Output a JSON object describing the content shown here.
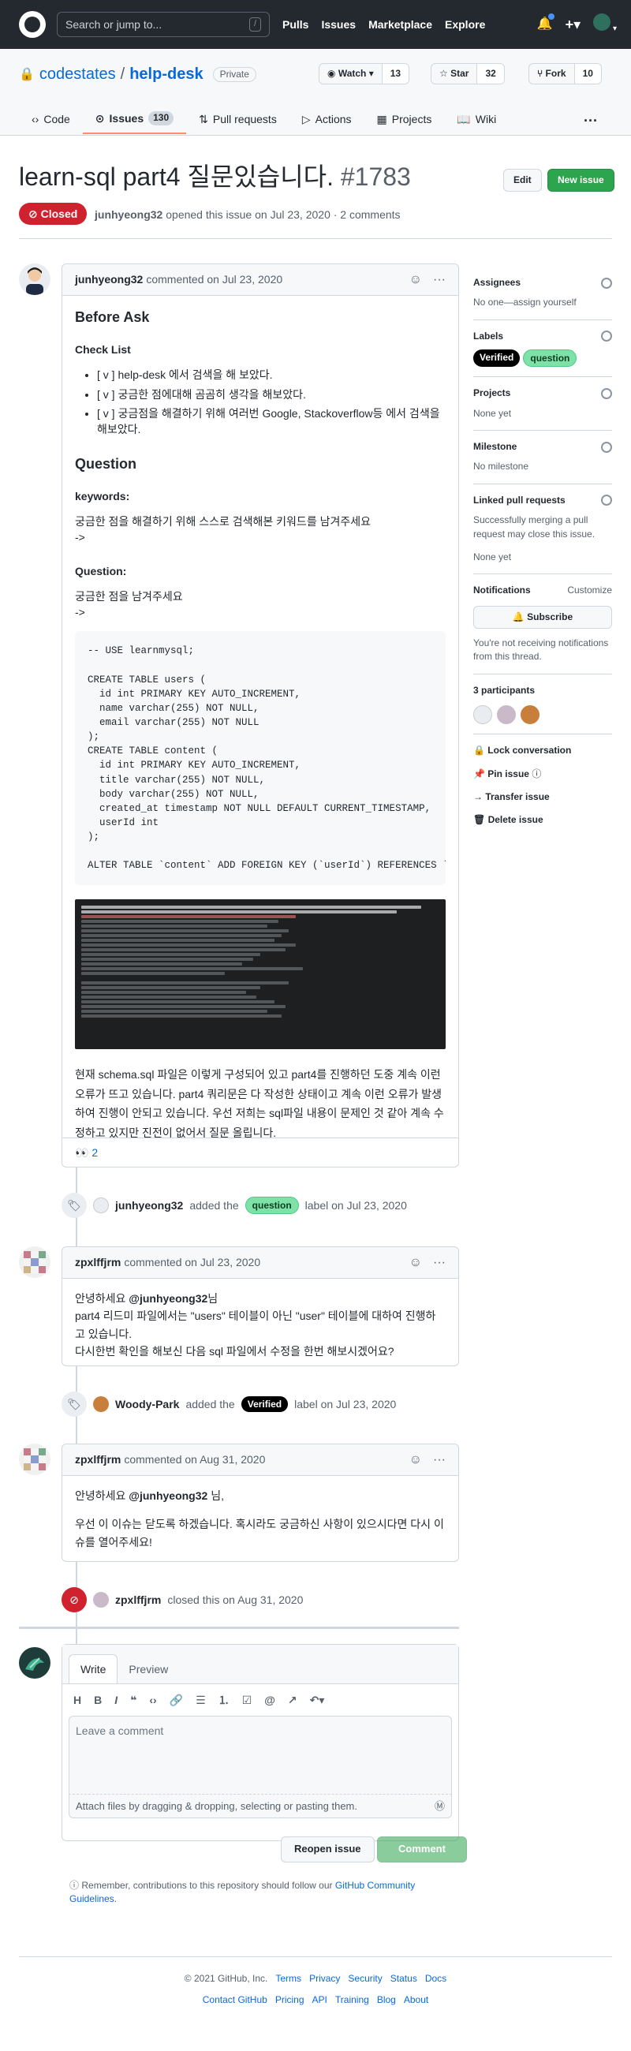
{
  "header": {
    "search_placeholder": "Search or jump to...",
    "search_kbd": "/",
    "nav": [
      "Pulls",
      "Issues",
      "Marketplace",
      "Explore"
    ]
  },
  "repo": {
    "owner": "codestates",
    "separator": "/",
    "name": "help-desk",
    "visibility": "Private",
    "watch_label": "Watch",
    "watch_count": "13",
    "star_label": "Star",
    "star_count": "32",
    "fork_label": "Fork",
    "fork_count": "10",
    "tabs": [
      {
        "label": "Code",
        "icon": "code-icon"
      },
      {
        "label": "Issues",
        "icon": "issue-icon",
        "count": "130"
      },
      {
        "label": "Pull requests",
        "icon": "pull-request-icon"
      },
      {
        "label": "Actions",
        "icon": "play-icon"
      },
      {
        "label": "Projects",
        "icon": "project-icon"
      },
      {
        "label": "Wiki",
        "icon": "book-icon"
      }
    ]
  },
  "issue": {
    "title": "learn-sql part4 질문있습니다.",
    "number": "#1783",
    "edit_label": "Edit",
    "new_issue_label": "New issue",
    "state": "Closed",
    "author": "junhyeong32",
    "meta_text": "opened this issue on Jul 23, 2020 · 2 comments"
  },
  "comment1": {
    "author": "junhyeong32",
    "meta": "commented on Jul 23, 2020",
    "h_before_ask": "Before Ask",
    "h_checklist": "Check List",
    "checklist": [
      "[ v ] help-desk 에서 검색을 해 보았다.",
      "[ v ] 궁금한 점에대해 곰곰히 생각을 해보았다.",
      "[ v ] 궁금점을 해결하기 위해 여러번 Google, Stackoverflow등 에서 검색을 해보았다."
    ],
    "h_question": "Question",
    "h_keywords": "keywords:",
    "keywords_text": "궁금한 점을 해결하기 위해 스스로 검색해본 키워드를 남겨주세요",
    "arrow1": "->",
    "h_question2": "Question:",
    "question_text": "궁금한 점을 남겨주세요",
    "arrow2": "->",
    "code": "-- USE learnmysql;\n\nCREATE TABLE users (\n  id int PRIMARY KEY AUTO_INCREMENT,\n  name varchar(255) NOT NULL,\n  email varchar(255) NOT NULL\n);\nCREATE TABLE content (\n  id int PRIMARY KEY AUTO_INCREMENT,\n  title varchar(255) NOT NULL,\n  body varchar(255) NOT NULL,\n  created_at timestamp NOT NULL DEFAULT CURRENT_TIMESTAMP,\n  userId int\n);\n\nALTER TABLE `content` ADD FOREIGN KEY (`userId`) REFERENCES `users`(`id`);",
    "body_text": "현재 schema.sql 파일은 이렇게 구성되어 있고 part4를 진행하던 도중 계속 이런 오류가 뜨고 있습니다. part4 쿼리문은 다 작성한 상태이고 계속 이런 오류가 발생하여 진행이 안되고 있습니다. 우선 저희는 sql파일 내용이 문제인 것 같아 계속 수정하고 있지만 진전이 없어서 질문 올립니다.",
    "reaction_emoji": "👀",
    "reaction_count": "2"
  },
  "event1": {
    "actor": "junhyeong32",
    "text1": "added the",
    "label": "question",
    "text2": "label on Jul 23, 2020"
  },
  "comment2": {
    "author": "zpxlffjrm",
    "meta": "commented on Jul 23, 2020",
    "greeting_pre": "안녕하세요",
    "mention": "@junhyeong32",
    "greeting_post": "님",
    "line1": "part4 리드미 파일에서는 \"users\" 테이블이 아닌 \"user\" 테이블에 대하여 진행하고 있습니다.",
    "line2": "다시한번 확인을 해보신 다음 sql 파일에서 수정을 한번 해보시겠어요?"
  },
  "event2": {
    "actor": "Woody-Park",
    "text1": "added the",
    "label": "Verified",
    "text2": "label on Jul 23, 2020"
  },
  "comment3": {
    "author": "zpxlffjrm",
    "meta": "commented on Aug 31, 2020",
    "greeting_pre": "안녕하세요",
    "mention": "@junhyeong32",
    "greeting_post": "님,",
    "body": "우선 이 이슈는 닫도록 하겠습니다. 혹시라도 궁금하신 사항이 있으시다면 다시 이슈를 열어주세요!"
  },
  "event3": {
    "actor": "zpxlffjrm",
    "text": "closed this on Aug 31, 2020"
  },
  "sidebar": {
    "assignees_h": "Assignees",
    "assignees_v": "No one—assign yourself",
    "labels_h": "Labels",
    "labels": [
      "Verified",
      "question"
    ],
    "projects_h": "Projects",
    "projects_v": "None yet",
    "milestone_h": "Milestone",
    "milestone_v": "No milestone",
    "linked_h": "Linked pull requests",
    "linked_desc": "Successfully merging a pull request may close this issue.",
    "linked_v": "None yet",
    "notifications_h": "Notifications",
    "customize": "Customize",
    "subscribe": "Subscribe",
    "notif_desc": "You're not receiving notifications from this thread.",
    "participants_h": "3 participants",
    "lock": "Lock conversation",
    "pin": "Pin issue",
    "transfer": "Transfer issue",
    "delete": "Delete issue"
  },
  "composer": {
    "tab_write": "Write",
    "tab_preview": "Preview",
    "placeholder": "Leave a comment",
    "attach": "Attach files by dragging & dropping, selecting or pasting them.",
    "reopen": "Reopen issue",
    "comment": "Comment",
    "remember_pre": "Remember, contributions to this repository should follow our",
    "remember_link": "GitHub Community Guidelines",
    "remember_post": "."
  },
  "footer": {
    "copyright": "© 2021 GitHub, Inc.",
    "row1": [
      "Terms",
      "Privacy",
      "Security",
      "Status",
      "Docs"
    ],
    "row2": [
      "Contact GitHub",
      "Pricing",
      "API",
      "Training",
      "Blog",
      "About"
    ]
  },
  "colors": {
    "closed": "#cf222e",
    "green": "#2da44e",
    "link": "#0969da",
    "question_label": "#7ee2a8",
    "verified_label": "#000000"
  }
}
